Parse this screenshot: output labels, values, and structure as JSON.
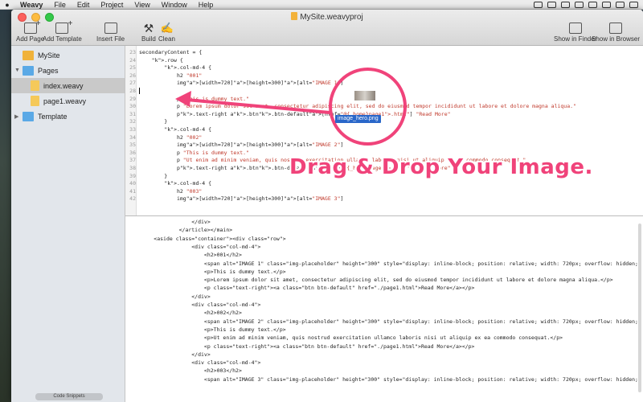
{
  "menubar": {
    "app": "Weavy",
    "items": [
      "File",
      "Edit",
      "Project",
      "View",
      "Window",
      "Help"
    ]
  },
  "window": {
    "title": "MySite.weavyproj"
  },
  "toolbar": {
    "add_page": "Add Page",
    "add_template": "Add Template",
    "insert_file": "Insert File",
    "build": "Build",
    "clean": "Clean",
    "show_in_finder": "Show in Finder",
    "show_in_browser": "Show in Browser"
  },
  "sidebar": {
    "items": [
      {
        "label": "MySite"
      },
      {
        "label": "Pages"
      },
      {
        "label": "index.weavy"
      },
      {
        "label": "page1.weavy"
      },
      {
        "label": "Template"
      }
    ],
    "snippets": "Code Snippets"
  },
  "editor": {
    "lines": [
      {
        "n": "23",
        "t": "secondaryContent = {"
      },
      {
        "n": "24",
        "t": "    .row {"
      },
      {
        "n": "25",
        "t": "        .col-md-4 {"
      },
      {
        "n": "26",
        "t": "            h2 \"001\""
      },
      {
        "n": "27",
        "t": "            img[width=720][height=300][alt=\"IMAGE 1\"]"
      },
      {
        "n": "28",
        "t": "            "
      },
      {
        "n": "29",
        "t": "            p \"This is dummy text.\""
      },
      {
        "n": "30",
        "t": "            p \"Lorem ipsum dolor sit amet, consectetur adipiscing elit, sed do eiusmod tempor incididunt ut labore et dolore magna aliqua.\""
      },
      {
        "n": "31",
        "t": "            p.text-right a.btn.btn-default[href=\"@{_home}page1.html\"] \"Read More\""
      },
      {
        "n": "32",
        "t": "        }"
      },
      {
        "n": "33",
        "t": "        .col-md-4 {"
      },
      {
        "n": "34",
        "t": "            h2 \"002\""
      },
      {
        "n": "35",
        "t": "            img[width=720][height=300][alt=\"IMAGE 2\"]"
      },
      {
        "n": "36",
        "t": "            p \"This is dummy text.\""
      },
      {
        "n": "37",
        "t": "            p \"Ut enim ad minim veniam, quis nostrud exercitation ullamco laboris nisi ut aliquip ex ea commodo consequat.\""
      },
      {
        "n": "38",
        "t": "            p.text-right a.btn.btn-default[href=\"@{_home}page1.html\"] \"Read More\""
      },
      {
        "n": "39",
        "t": "        }"
      },
      {
        "n": "40",
        "t": "        .col-md-4 {"
      },
      {
        "n": "41",
        "t": "            h2 \"003\""
      },
      {
        "n": "42",
        "t": "            img[width=720][height=300][alt=\"IMAGE 3\"]"
      }
    ]
  },
  "preview": {
    "lines": [
      "                    </div>",
      "                </article></main>",
      "        <aside class=\"container\"><div class=\"row\">",
      "                    <div class=\"col-md-4\">",
      "                        <h2>001</h2>",
      "                        <span alt=\"IMAGE 1\" class=\"img-placeholder\" height=\"300\" style=\"display: inline-block; position: relative; width: 720px; overflow: hidden;",
      "                        <p>This is dummy text.</p>",
      "                        <p>Lorem ipsum dolor sit amet, consectetur adipiscing elit, sed do eiusmod tempor incididunt ut labore et dolore magna aliqua.</p>",
      "                        <p class=\"text-right\"><a class=\"btn btn-default\" href=\"./page1.html\">Read More</a></p>",
      "                    </div>",
      "                    <div class=\"col-md-4\">",
      "                        <h2>002</h2>",
      "                        <span alt=\"IMAGE 2\" class=\"img-placeholder\" height=\"300\" style=\"display: inline-block; position: relative; width: 720px; overflow: hidden;",
      "                        <p>This is dummy text.</p>",
      "                        <p>Ut enim ad minim veniam, quis nostrud exercitation ullamco laboris nisi ut aliquip ex ea commodo consequat.</p>",
      "                        <p class=\"text-right\"><a class=\"btn btn-default\" href=\"./page1.html\">Read More</a></p>",
      "                    </div>",
      "                    <div class=\"col-md-4\">",
      "                        <h2>003</h2>",
      "                        <span alt=\"IMAGE 3\" class=\"img-placeholder\" height=\"300\" style=\"display: inline-block; position: relative; width: 720px; overflow: hidden;"
    ]
  },
  "overlay": {
    "drag_file": "image_hero.png",
    "banner": "Drag & Drop Your Image.",
    "accent_color": "#f0437a"
  }
}
